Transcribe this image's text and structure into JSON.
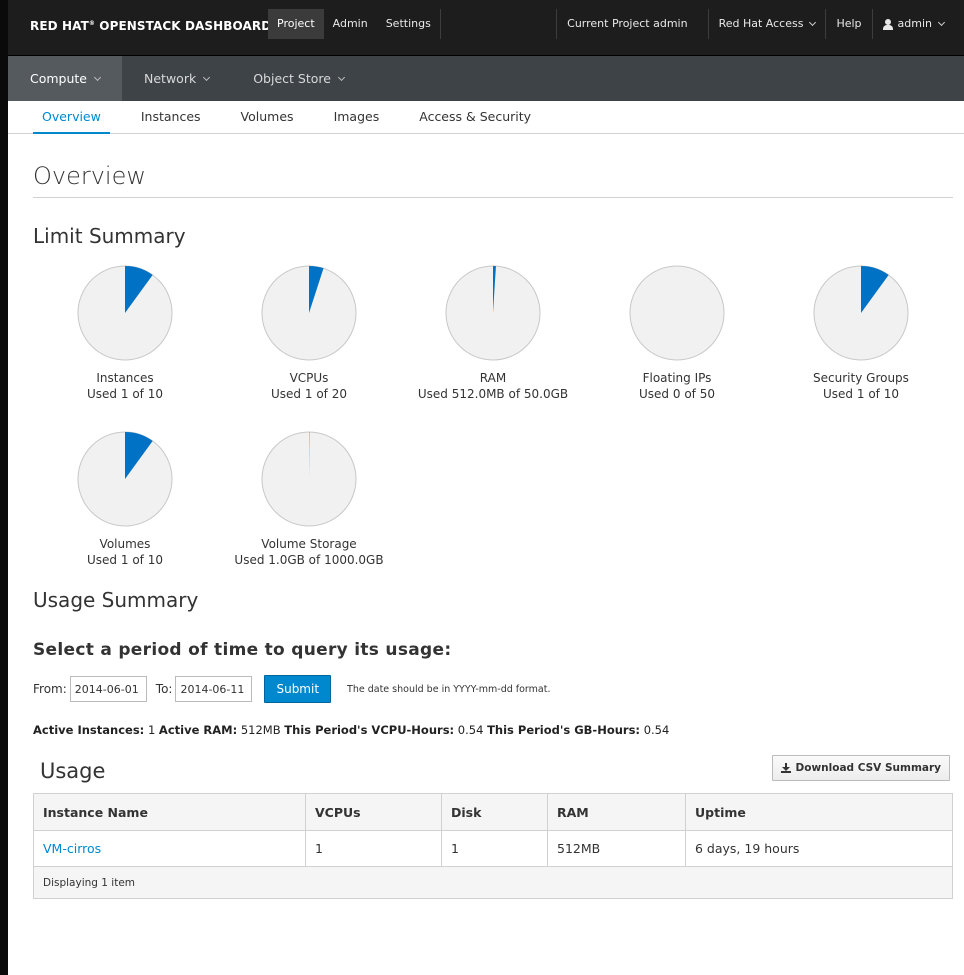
{
  "brand": {
    "text": "RED HAT",
    "suffix": " OPENSTACK DASHBOARD",
    "mark": "®"
  },
  "topnav": {
    "items": [
      {
        "label": "Project",
        "active": true
      },
      {
        "label": "Admin",
        "active": false
      },
      {
        "label": "Settings",
        "active": false
      }
    ],
    "current_project": "Current Project admin",
    "red_hat_access": "Red Hat Access",
    "help": "Help",
    "user": "admin"
  },
  "subnav": {
    "items": [
      {
        "label": "Compute",
        "active": true
      },
      {
        "label": "Network",
        "active": false
      },
      {
        "label": "Object Store",
        "active": false
      }
    ]
  },
  "tabs": [
    {
      "label": "Overview",
      "active": true
    },
    {
      "label": "Instances",
      "active": false
    },
    {
      "label": "Volumes",
      "active": false
    },
    {
      "label": "Images",
      "active": false
    },
    {
      "label": "Access & Security",
      "active": false
    }
  ],
  "page_title": "Overview",
  "limit_summary": {
    "title": "Limit Summary",
    "pies": [
      {
        "name": "Instances",
        "usage": "Used 1 of 10",
        "fraction": 0.1
      },
      {
        "name": "VCPUs",
        "usage": "Used 1 of 20",
        "fraction": 0.05
      },
      {
        "name": "RAM",
        "usage": "Used 512.0MB of 50.0GB",
        "fraction": 0.01
      },
      {
        "name": "Floating IPs",
        "usage": "Used 0 of 50",
        "fraction": 0
      },
      {
        "name": "Security Groups",
        "usage": "Used 1 of 10",
        "fraction": 0.1
      },
      {
        "name": "Volumes",
        "usage": "Used 1 of 10",
        "fraction": 0.1
      },
      {
        "name": "Volume Storage",
        "usage": "Used 1.0GB of 1000.0GB",
        "fraction": 0.001
      }
    ]
  },
  "colors": {
    "pie_used": "#0072c6",
    "pie_free": "#f1f1f1",
    "pie_border": "#c8c8c8",
    "accent": "#0088ce"
  },
  "usage_summary": {
    "title": "Usage Summary",
    "period_title": "Select a period of time to query its usage:",
    "from_label": "From:",
    "from_value": "2014-06-01",
    "to_label": "To:",
    "to_value": "2014-06-11",
    "submit_label": "Submit",
    "hint": "The date should be in YYYY-mm-dd format.",
    "stats": {
      "active_instances_label": "Active Instances:",
      "active_instances": "1",
      "active_ram_label": "Active RAM:",
      "active_ram": "512MB",
      "vcpu_hours_label": "This Period's VCPU-Hours:",
      "vcpu_hours": "0.54",
      "gb_hours_label": "This Period's GB-Hours:",
      "gb_hours": "0.54"
    }
  },
  "usage": {
    "title": "Usage",
    "csv_label": "Download CSV Summary",
    "headers": [
      "Instance Name",
      "VCPUs",
      "Disk",
      "RAM",
      "Uptime"
    ],
    "rows": [
      [
        "VM-cirros",
        "1",
        "1",
        "512MB",
        "6 days, 19 hours"
      ]
    ],
    "footer": "Displaying 1 item"
  }
}
